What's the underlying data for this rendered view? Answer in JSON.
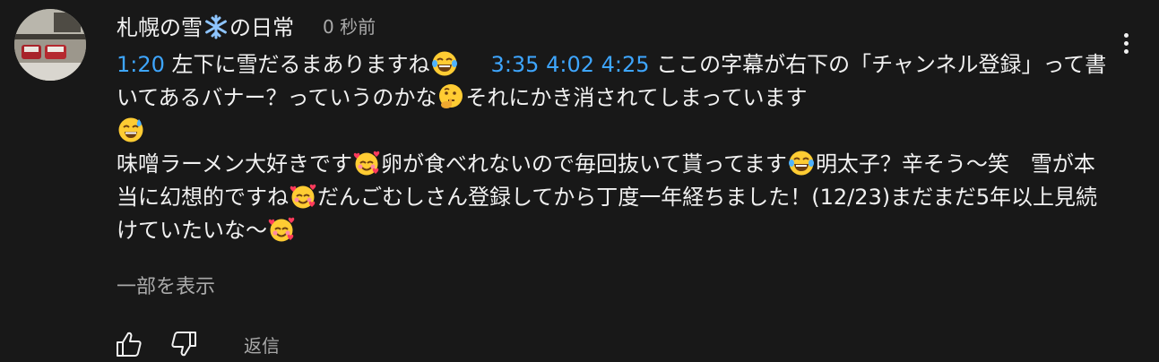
{
  "comment": {
    "author": "札幌の雪❄️の日常",
    "author_prefix": "札幌の雪",
    "author_suffix": "の日常",
    "time": "0 秒前",
    "segments": {
      "ts1": "1:20",
      "t1": " 左下に雪だるまありますね",
      "ts2": "3:35",
      "ts3": "4:02",
      "ts4": "4:25",
      "t2": " ここの字幕が右下の「チャンネル登録」って書いてあるバナー？っていうのかな",
      "t3": "それにかき消されてしまっています",
      "t4": "味噌ラーメン大好きです",
      "t5": "卵が食べれないので毎回抜いて貰ってます",
      "t6": "明太子？辛そう〜笑　雪が本当に幻想的ですね",
      "t7": "だんごむしさん登録してから丁度一年経ちました！(12/23)まだまだ5年以上見続けていたいな〜"
    },
    "emojis": [
      "snowflake-emoji",
      "joy-emoji",
      "thinking-emoji",
      "sweat-smile-emoji",
      "smiling-hearts-emoji",
      "joy-emoji",
      "smiling-hearts-emoji",
      "smiling-hearts-emoji"
    ],
    "show_more": "一部を表示",
    "reply": "返信"
  },
  "icons": [
    "kebab-menu-icon",
    "like-icon",
    "dislike-icon"
  ],
  "colors": {
    "background": "#181818",
    "text": "#f1f1f1",
    "secondary": "#aaaaaa",
    "link": "#3ea6ff"
  }
}
